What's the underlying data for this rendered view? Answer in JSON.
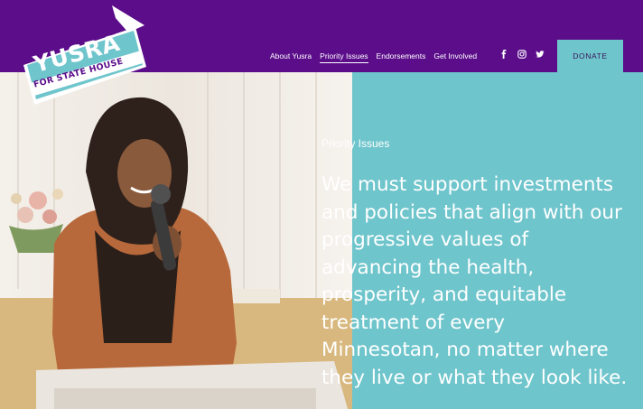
{
  "logo": {
    "name": "YUSRA",
    "subtitle": "FOR STATE HOUSE"
  },
  "nav": {
    "items": [
      {
        "label": "About Yusra"
      },
      {
        "label": "Priority Issues"
      },
      {
        "label": "Endorsements"
      },
      {
        "label": "Get Involved"
      }
    ],
    "active_index": 1
  },
  "socials": [
    "facebook-icon",
    "instagram-icon",
    "twitter-icon"
  ],
  "donate": {
    "label": "DONATE"
  },
  "hero": {
    "label": "Priority Issues",
    "headline": "We must support investments and policies that align with our progressive values of advancing the health, prosperity, and equitable treatment of every Minnesotan, no matter where they live or what they look like."
  },
  "colors": {
    "header_bg": "#5b0d8a",
    "accent": "#6fc5cc",
    "text": "#ffffff"
  }
}
